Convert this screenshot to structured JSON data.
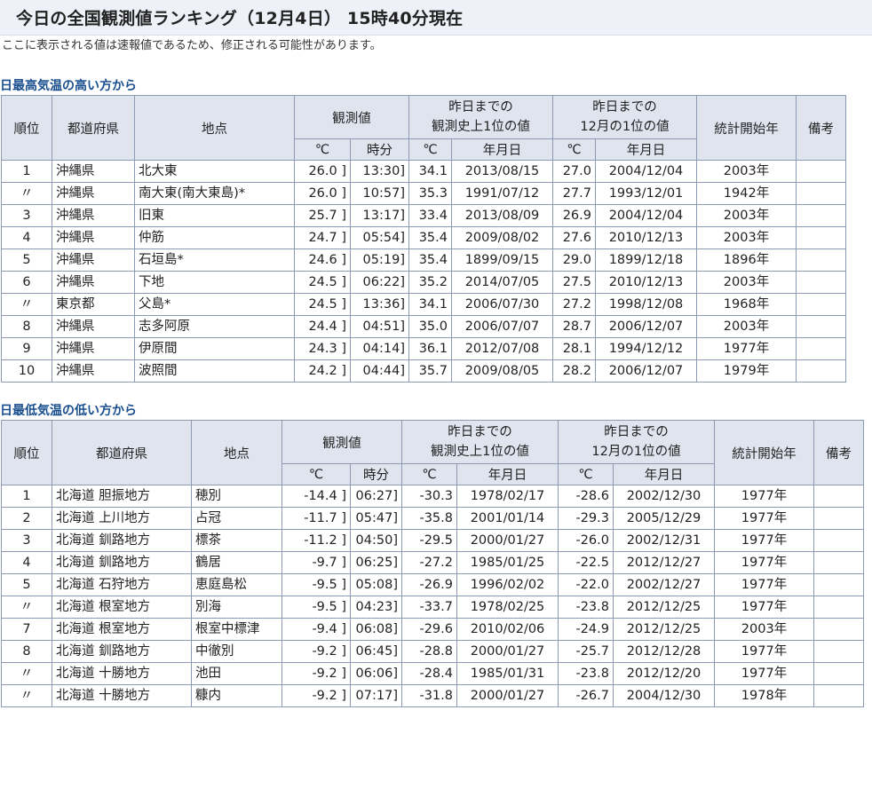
{
  "title": "今日の全国観測値ランキング（12月4日） 15時40分現在",
  "notice": "ここに表示される値は速報値であるため、修正される可能性があります。",
  "headers": {
    "rank": "順位",
    "pref": "都道府県",
    "station": "地点",
    "observed": "観測値",
    "record_all": "昨日までの\n観測史上1位の値",
    "record_month": "昨日までの\n12月の1位の値",
    "stat_start": "統計開始年",
    "note": "備考",
    "celsius": "℃",
    "time": "時分",
    "date": "年月日"
  },
  "high": {
    "title": "日最高気温の高い方から",
    "rows": [
      {
        "rank": "1",
        "pref": "沖縄県",
        "station": "北大東",
        "value": "26.0 ]",
        "time": "13:30]",
        "rec_val": "34.1",
        "rec_date": "2013/08/15",
        "mon_val": "27.0",
        "mon_date": "2004/12/04",
        "start": "2003年",
        "note": ""
      },
      {
        "rank": "〃",
        "pref": "沖縄県",
        "station": "南大東(南大東島)*",
        "value": "26.0 ]",
        "time": "10:57]",
        "rec_val": "35.3",
        "rec_date": "1991/07/12",
        "mon_val": "27.7",
        "mon_date": "1993/12/01",
        "start": "1942年",
        "note": ""
      },
      {
        "rank": "3",
        "pref": "沖縄県",
        "station": "旧東",
        "value": "25.7 ]",
        "time": "13:17]",
        "rec_val": "33.4",
        "rec_date": "2013/08/09",
        "mon_val": "26.9",
        "mon_date": "2004/12/04",
        "start": "2003年",
        "note": ""
      },
      {
        "rank": "4",
        "pref": "沖縄県",
        "station": "仲筋",
        "value": "24.7 ]",
        "time": "05:54]",
        "rec_val": "35.4",
        "rec_date": "2009/08/02",
        "mon_val": "27.6",
        "mon_date": "2010/12/13",
        "start": "2003年",
        "note": ""
      },
      {
        "rank": "5",
        "pref": "沖縄県",
        "station": "石垣島*",
        "value": "24.6 ]",
        "time": "05:19]",
        "rec_val": "35.4",
        "rec_date": "1899/09/15",
        "mon_val": "29.0",
        "mon_date": "1899/12/18",
        "start": "1896年",
        "note": ""
      },
      {
        "rank": "6",
        "pref": "沖縄県",
        "station": "下地",
        "value": "24.5 ]",
        "time": "06:22]",
        "rec_val": "35.2",
        "rec_date": "2014/07/05",
        "mon_val": "27.5",
        "mon_date": "2010/12/13",
        "start": "2003年",
        "note": ""
      },
      {
        "rank": "〃",
        "pref": "東京都",
        "station": "父島*",
        "value": "24.5 ]",
        "time": "13:36]",
        "rec_val": "34.1",
        "rec_date": "2006/07/30",
        "mon_val": "27.2",
        "mon_date": "1998/12/08",
        "start": "1968年",
        "note": ""
      },
      {
        "rank": "8",
        "pref": "沖縄県",
        "station": "志多阿原",
        "value": "24.4 ]",
        "time": "04:51]",
        "rec_val": "35.0",
        "rec_date": "2006/07/07",
        "mon_val": "28.7",
        "mon_date": "2006/12/07",
        "start": "2003年",
        "note": ""
      },
      {
        "rank": "9",
        "pref": "沖縄県",
        "station": "伊原間",
        "value": "24.3 ]",
        "time": "04:14]",
        "rec_val": "36.1",
        "rec_date": "2012/07/08",
        "mon_val": "28.1",
        "mon_date": "1994/12/12",
        "start": "1977年",
        "note": ""
      },
      {
        "rank": "10",
        "pref": "沖縄県",
        "station": "波照間",
        "value": "24.2 ]",
        "time": "04:44]",
        "rec_val": "35.7",
        "rec_date": "2009/08/05",
        "mon_val": "28.2",
        "mon_date": "2006/12/07",
        "start": "1979年",
        "note": ""
      }
    ]
  },
  "low": {
    "title": "日最低気温の低い方から",
    "rows": [
      {
        "rank": "1",
        "pref": "北海道 胆振地方",
        "station": "穂別",
        "value": "-14.4 ]",
        "time": "06:27]",
        "rec_val": "-30.3",
        "rec_date": "1978/02/17",
        "mon_val": "-28.6",
        "mon_date": "2002/12/30",
        "start": "1977年",
        "note": ""
      },
      {
        "rank": "2",
        "pref": "北海道 上川地方",
        "station": "占冠",
        "value": "-11.7 ]",
        "time": "05:47]",
        "rec_val": "-35.8",
        "rec_date": "2001/01/14",
        "mon_val": "-29.3",
        "mon_date": "2005/12/29",
        "start": "1977年",
        "note": ""
      },
      {
        "rank": "3",
        "pref": "北海道 釧路地方",
        "station": "標茶",
        "value": "-11.2 ]",
        "time": "04:50]",
        "rec_val": "-29.5",
        "rec_date": "2000/01/27",
        "mon_val": "-26.0",
        "mon_date": "2002/12/31",
        "start": "1977年",
        "note": ""
      },
      {
        "rank": "4",
        "pref": "北海道 釧路地方",
        "station": "鶴居",
        "value": "-9.7 ]",
        "time": "06:25]",
        "rec_val": "-27.2",
        "rec_date": "1985/01/25",
        "mon_val": "-22.5",
        "mon_date": "2012/12/27",
        "start": "1977年",
        "note": ""
      },
      {
        "rank": "5",
        "pref": "北海道 石狩地方",
        "station": "恵庭島松",
        "value": "-9.5 ]",
        "time": "05:08]",
        "rec_val": "-26.9",
        "rec_date": "1996/02/02",
        "mon_val": "-22.0",
        "mon_date": "2002/12/27",
        "start": "1977年",
        "note": ""
      },
      {
        "rank": "〃",
        "pref": "北海道 根室地方",
        "station": "別海",
        "value": "-9.5 ]",
        "time": "04:23]",
        "rec_val": "-33.7",
        "rec_date": "1978/02/25",
        "mon_val": "-23.8",
        "mon_date": "2012/12/25",
        "start": "1977年",
        "note": ""
      },
      {
        "rank": "7",
        "pref": "北海道 根室地方",
        "station": "根室中標津",
        "value": "-9.4 ]",
        "time": "06:08]",
        "rec_val": "-29.6",
        "rec_date": "2010/02/06",
        "mon_val": "-24.9",
        "mon_date": "2012/12/25",
        "start": "2003年",
        "note": ""
      },
      {
        "rank": "8",
        "pref": "北海道 釧路地方",
        "station": "中徹別",
        "value": "-9.2 ]",
        "time": "06:45]",
        "rec_val": "-28.8",
        "rec_date": "2000/01/27",
        "mon_val": "-25.7",
        "mon_date": "2012/12/28",
        "start": "1977年",
        "note": ""
      },
      {
        "rank": "〃",
        "pref": "北海道 十勝地方",
        "station": "池田",
        "value": "-9.2 ]",
        "time": "06:06]",
        "rec_val": "-28.4",
        "rec_date": "1985/01/31",
        "mon_val": "-23.8",
        "mon_date": "2012/12/20",
        "start": "1977年",
        "note": ""
      },
      {
        "rank": "〃",
        "pref": "北海道 十勝地方",
        "station": "糠内",
        "value": "-9.2 ]",
        "time": "07:17]",
        "rec_val": "-31.8",
        "rec_date": "2000/01/27",
        "mon_val": "-26.7",
        "mon_date": "2004/12/30",
        "start": "1978年",
        "note": ""
      }
    ]
  }
}
